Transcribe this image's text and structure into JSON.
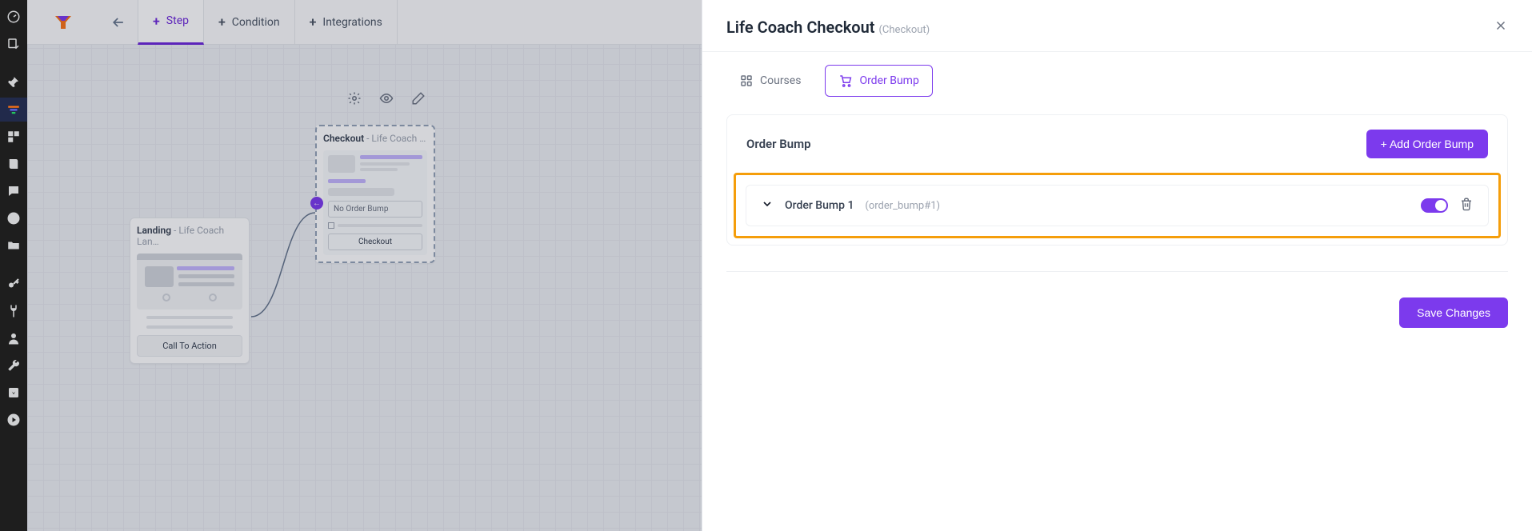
{
  "topbar": {
    "step_label": "Step",
    "condition_label": "Condition",
    "integrations_label": "Integrations"
  },
  "canvas": {
    "landing": {
      "title": "Landing",
      "subtitle": " - Life Coach Lan…",
      "cta": "Call To Action"
    },
    "checkout": {
      "title": "Checkout",
      "subtitle": " - Life Coach …",
      "no_bump": "No Order Bump",
      "checkout_btn": "Checkout"
    }
  },
  "panel": {
    "title": "Life Coach Checkout",
    "title_sub": "(Checkout)",
    "tabs": {
      "courses": "Courses",
      "order_bump": "Order Bump"
    },
    "section_title": "Order Bump",
    "add_button": "+ Add Order Bump",
    "item": {
      "name": "Order Bump 1",
      "id": "(order_bump#1)"
    },
    "save": "Save Changes"
  }
}
